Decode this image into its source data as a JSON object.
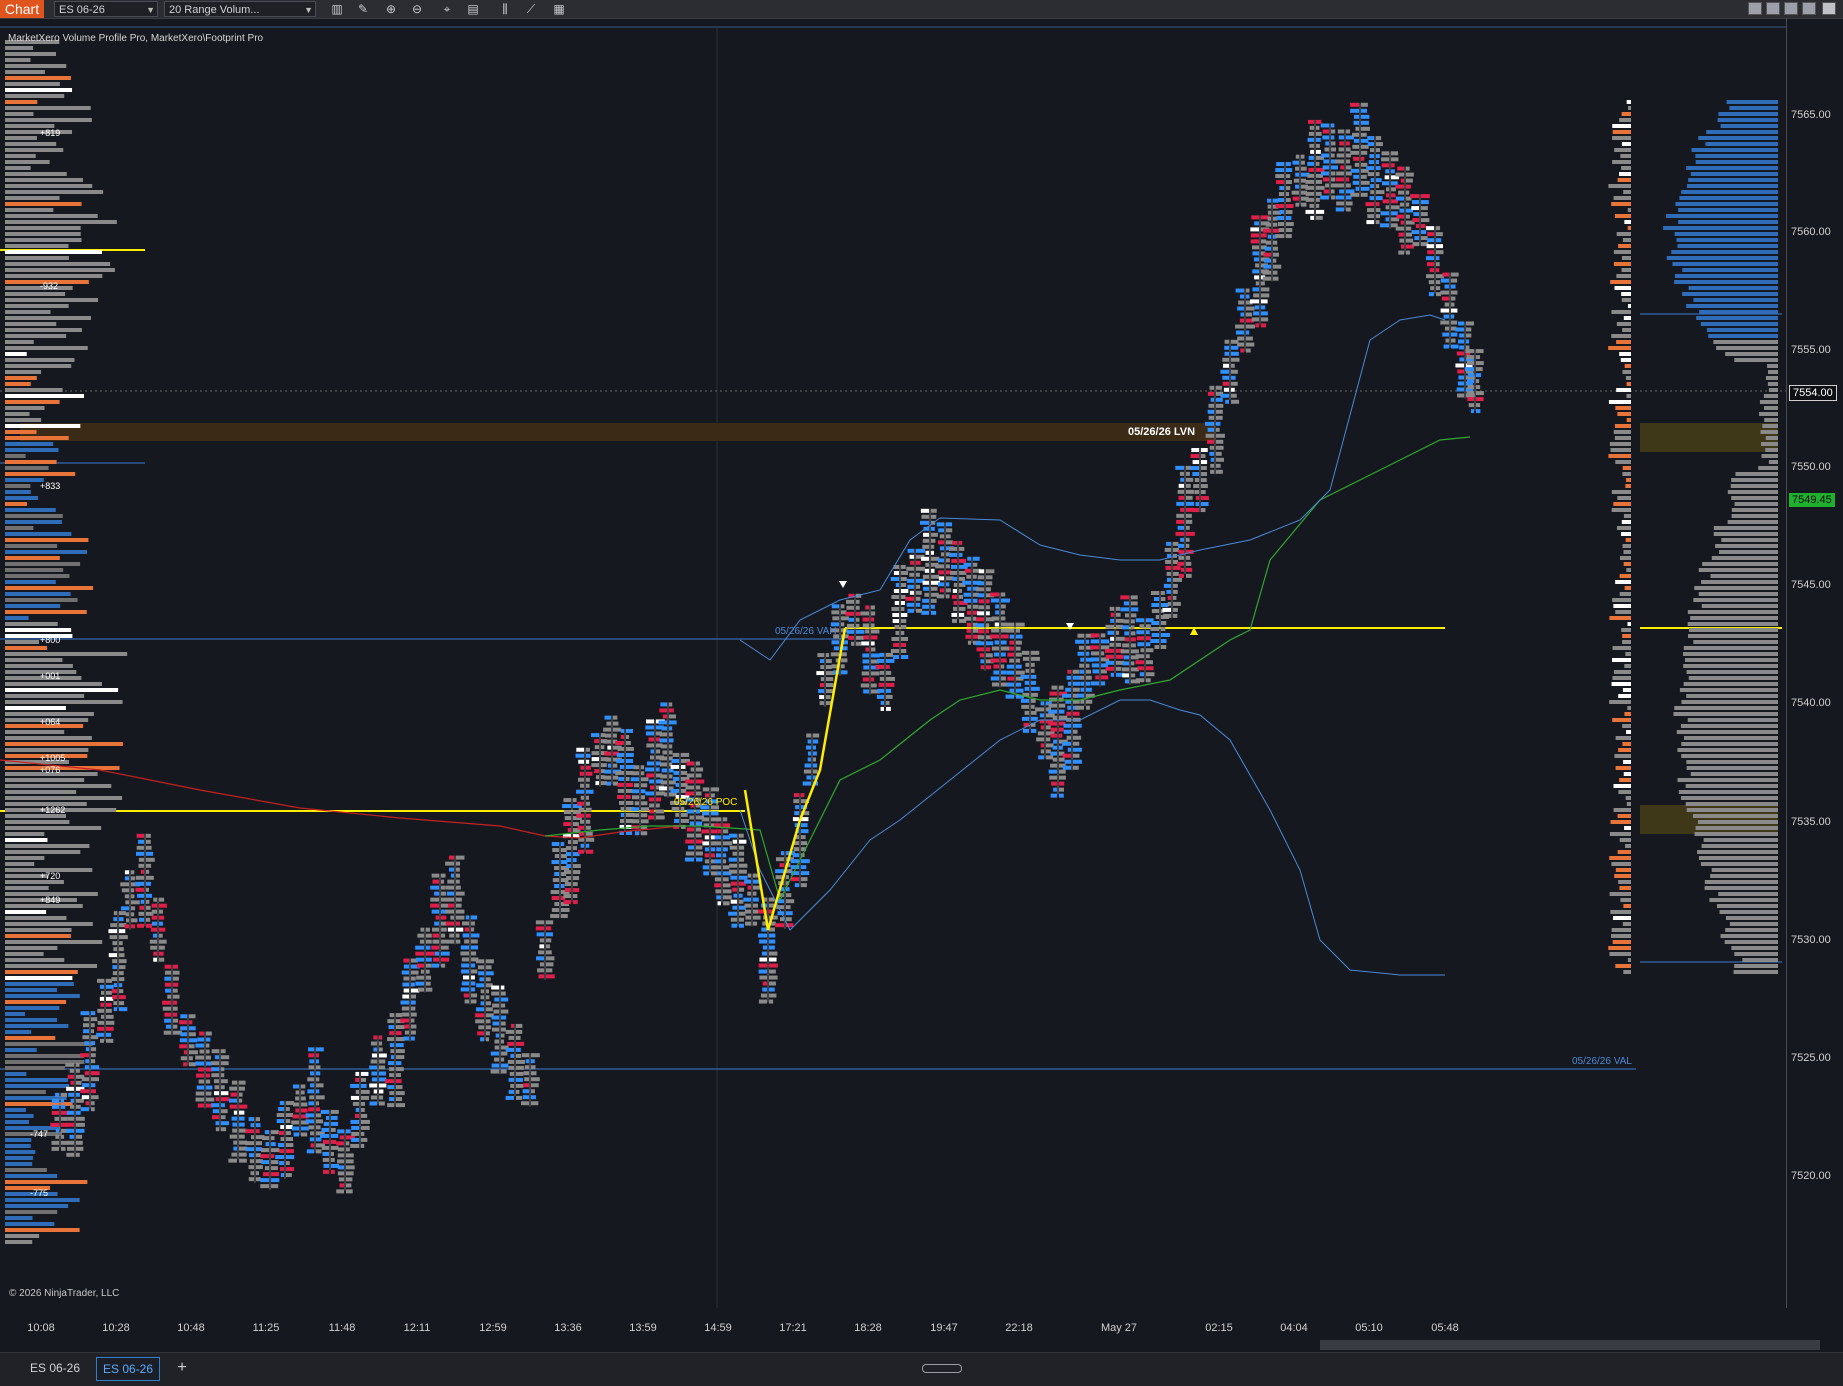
{
  "toolbar": {
    "chart_tab": "Chart",
    "instrument": "ES 06-26",
    "bar_type": "20 Range Volum...",
    "icons": [
      "bar-type-icon",
      "pencil-icon",
      "zoom-in-icon",
      "zoom-out-icon",
      "crosshair-icon",
      "properties-icon",
      "indicators-icon",
      "strategies-icon",
      "chart-trader-icon"
    ]
  },
  "chart": {
    "indicator_label": "MarketXero Volume Profile Pro, MarketXero\\Footprint Pro",
    "copyright": "© 2026 NinjaTrader, LLC",
    "lvn_label": "05/26/26 LVN",
    "vah_label": "05/26/26 VAH",
    "poc_label": "05/26/26 POC",
    "val_label": "05/26/26 VAL",
    "colors": {
      "background": "#16181f",
      "buy_blue": "#2f8fff",
      "sell_red": "#e01e4a",
      "neutral_gray": "#8a8a8a",
      "poc_yellow": "#ffee00",
      "vwap_green": "#2fa82f",
      "band_blue": "#4a8ad8",
      "red_line": "#c42222",
      "lvn_zone": "#3a2a16",
      "value_zone": "#3e3818"
    }
  },
  "left_profile": {
    "delta_labels": [
      "+819",
      "-932",
      "+833",
      "+800",
      "+001",
      "+064",
      "+1005",
      "+076",
      "+1262",
      "+720",
      "+849",
      "-747",
      "-775"
    ]
  },
  "price_axis": {
    "ticks": [
      "7565.00",
      "7560.00",
      "7555.00",
      "7550.00",
      "7545.00",
      "7540.00",
      "7535.00",
      "7530.00",
      "7525.00",
      "7520.00"
    ],
    "last_price": "7554.00",
    "vwap_price": "7549.45"
  },
  "time_axis": {
    "labels": [
      "10:08",
      "10:28",
      "10:48",
      "11:25",
      "11:48",
      "12:11",
      "12:59",
      "13:36",
      "13:59",
      "14:59",
      "17:21",
      "18:28",
      "19:47",
      "22:18",
      "May 27",
      "02:15",
      "04:04",
      "05:10",
      "05:48"
    ]
  },
  "bottom_tabs": {
    "tabs": [
      "ES 06-26",
      "ES 06-26"
    ],
    "add_label": "+"
  }
}
